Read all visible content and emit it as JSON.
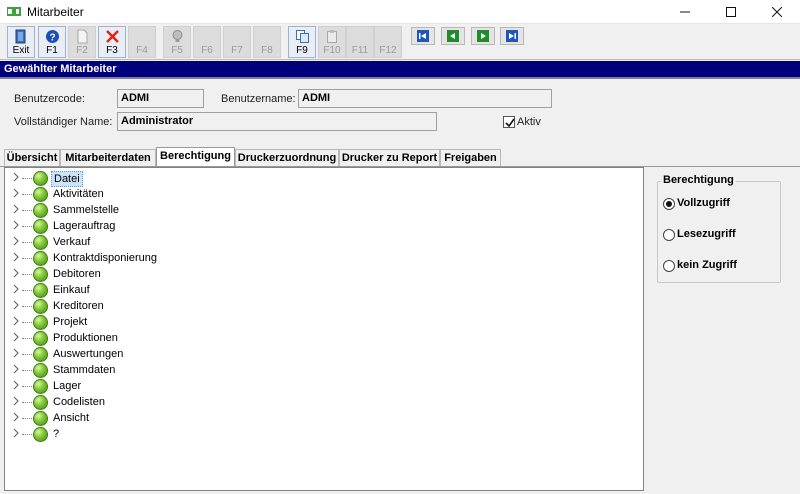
{
  "window": {
    "title": "Mitarbeiter"
  },
  "toolbar": {
    "buttons": [
      {
        "label": "Exit",
        "icon": "exit-door-icon",
        "enabled": true
      },
      {
        "label": "F1",
        "icon": "help-icon",
        "enabled": true
      },
      {
        "label": "F2",
        "icon": "new-document-icon",
        "enabled": false
      },
      {
        "label": "F3",
        "icon": "delete-x-icon",
        "enabled": true
      },
      {
        "label": "F4",
        "icon": "",
        "enabled": false
      },
      {
        "label": "F5",
        "icon": "bulb-icon",
        "enabled": false
      },
      {
        "label": "F6",
        "icon": "",
        "enabled": false
      },
      {
        "label": "F7",
        "icon": "",
        "enabled": false
      },
      {
        "label": "F8",
        "icon": "",
        "enabled": false
      },
      {
        "label": "F9",
        "icon": "copy-icon",
        "enabled": true
      },
      {
        "label": "F10",
        "icon": "paste-icon",
        "enabled": false
      },
      {
        "label": "F11",
        "icon": "",
        "enabled": false
      },
      {
        "label": "F12",
        "icon": "",
        "enabled": false
      }
    ],
    "nav": [
      "first-record-icon",
      "previous-record-icon",
      "next-record-icon",
      "last-record-icon"
    ]
  },
  "header": {
    "title": "Gewählter Mitarbeiter"
  },
  "form": {
    "usercode_label": "Benutzercode:",
    "usercode_value": "ADMI",
    "username_label": "Benutzername:",
    "username_value": "ADMI",
    "fullname_label": "Vollständiger Name:",
    "fullname_value": "Administrator",
    "active_label": "Aktiv",
    "active_checked": true
  },
  "tabs": [
    "Übersicht",
    "Mitarbeiterdaten",
    "Berechtigung",
    "Druckerzuordnung",
    "Drucker zu Report",
    "Freigaben"
  ],
  "active_tab": "Berechtigung",
  "tree": {
    "items": [
      "Datei",
      "Aktivitäten",
      "Sammelstelle",
      "Lagerauftrag",
      "Verkauf",
      "Kontraktdisponierung",
      "Debitoren",
      "Einkauf",
      "Kreditoren",
      "Projekt",
      "Produktionen",
      "Auswertungen",
      "Stammdaten",
      "Lager",
      "Codelisten",
      "Ansicht",
      "?"
    ],
    "selected": "Datei"
  },
  "permission": {
    "title": "Berechtigung",
    "options": [
      "Vollzugriff",
      "Lesezugriff",
      "kein Zugriff"
    ],
    "selected": "Vollzugriff"
  },
  "colors": {
    "header_bg": "#00007b",
    "status_green": "#7fc631",
    "selection": "#cce4f7"
  }
}
